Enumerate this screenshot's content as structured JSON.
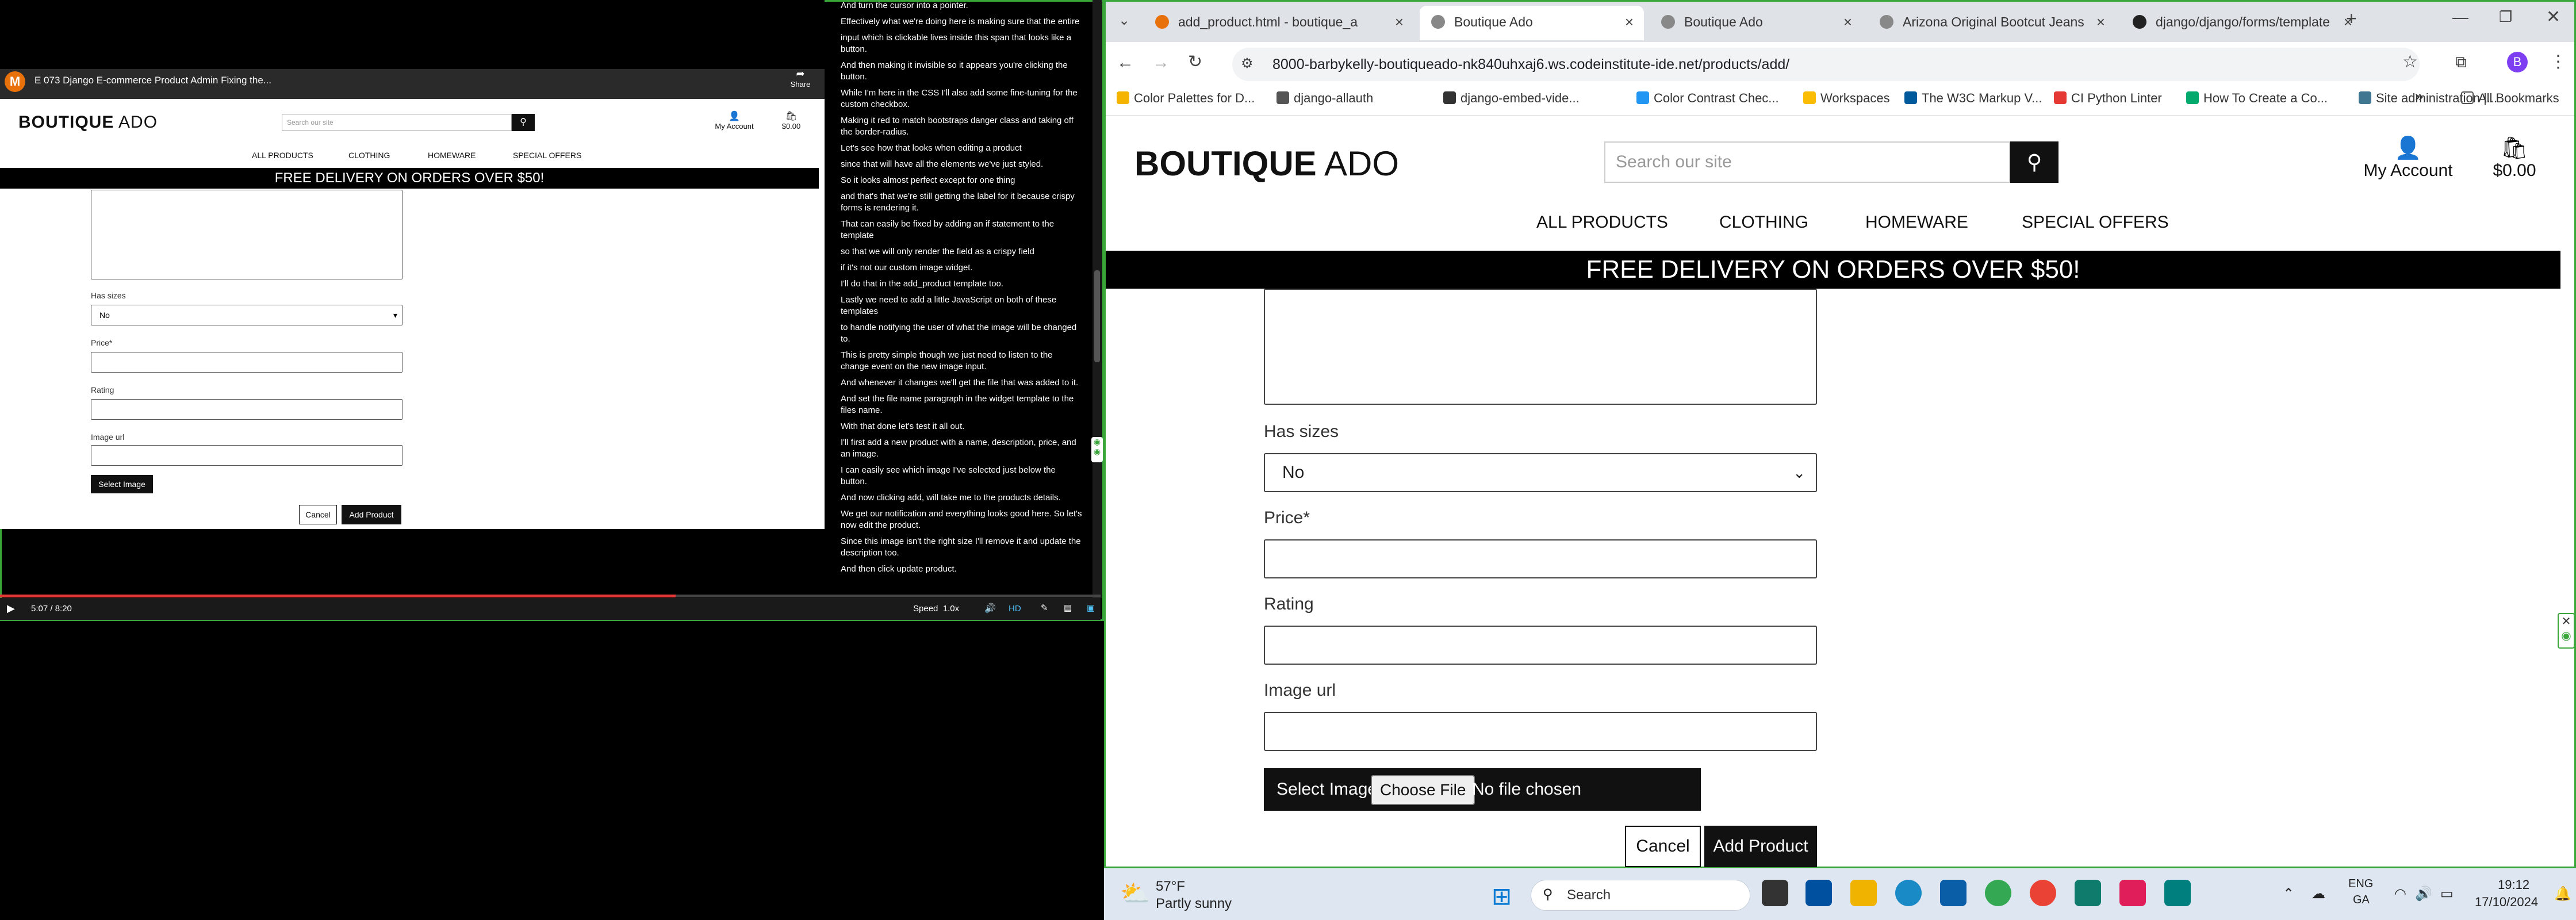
{
  "video": {
    "title": "E 073 Django E-commerce Product Admin Fixing the...",
    "avatar_letter": "M",
    "share_label": "Share",
    "time": "5:07 / 8:20",
    "progress": 0.614,
    "speed_label": "Speed",
    "speed_value": "1.0x",
    "quality": "HD",
    "site": {
      "logo_bold": "BOUTIQUE",
      "logo_light": "ADO",
      "search_placeholder": "Search our site",
      "account_label": "My Account",
      "cart_total": "$0.00",
      "nav": [
        "ALL PRODUCTS",
        "CLOTHING",
        "HOMEWARE",
        "SPECIAL OFFERS"
      ],
      "banner": "FREE DELIVERY ON ORDERS OVER $50!",
      "has_sizes_label": "Has sizes",
      "has_sizes_value": "No",
      "price_label": "Price*",
      "rating_label": "Rating",
      "image_url_label": "Image url",
      "select_image": "Select Image",
      "cancel": "Cancel",
      "add_product": "Add Product"
    },
    "captions": [
      "And turn the cursor into a pointer.",
      "Effectively what we're doing here is making sure that the entire",
      "input which is clickable lives inside this span that looks like a button.",
      "And then making it invisible so it appears you're clicking the button.",
      "While I'm here in the CSS I'll also add some fine-tuning for the custom checkbox.",
      "Making it red to match bootstraps danger class and taking off the border-radius.",
      "Let's see how that looks when editing a product",
      "since that will have all the elements we've just styled.",
      "So it looks almost perfect except for one thing",
      "and that's that we're still getting the label for it because crispy forms is rendering it.",
      "That can easily be fixed by adding an if statement to the template",
      "so that we will only render the field as a crispy field",
      "if it's not our custom image widget.",
      "I'll do that in the add_product template too.",
      "Lastly we need to add a little JavaScript on both of these templates",
      "to handle notifying the user of what the image will be changed to.",
      "This is pretty simple though we just need to listen to the change event on the new image input.",
      "And whenever it changes we'll get the file that was added to it.",
      "And set the file name paragraph in the widget template to the files name.",
      "With that done let's test it all out.",
      "I'll first add a new product with a name, description, price, and an image.",
      "I can easily see which image I've selected just below the button.",
      "And now clicking add, will take me to the products details.",
      "We get our notification and everything looks good here. So let's now edit the product.",
      "Since this image isn't the right size I'll remove it and update the description too.",
      "And then click update product."
    ]
  },
  "browser": {
    "tabs": [
      {
        "title": "add_product.html - boutique_a",
        "color": "#e8710a"
      },
      {
        "title": "Boutique Ado",
        "color": "#888888"
      },
      {
        "title": "Boutique Ado",
        "color": "#888888"
      },
      {
        "title": "Arizona Original Bootcut Jeans",
        "color": "#888888"
      },
      {
        "title": "django/django/forms/template",
        "color": "#222222"
      }
    ],
    "new_tab": "+",
    "url": "8000-barbykelly-boutiqueado-nk840uhxaj6.ws.codeinstitute-ide.net/products/add/",
    "profile_letter": "B",
    "bookmarks": [
      {
        "label": "Color Palettes for D...",
        "color": "#f4b400"
      },
      {
        "label": "django-allauth",
        "color": "#555555"
      },
      {
        "label": "django-embed-vide...",
        "color": "#333333"
      },
      {
        "label": "Color Contrast Chec...",
        "color": "#2196f3"
      },
      {
        "label": "Workspaces",
        "color": "#fbbc04"
      },
      {
        "label": "The W3C Markup V...",
        "color": "#005a9c"
      },
      {
        "label": "CI Python Linter",
        "color": "#e53935"
      },
      {
        "label": "How To Create a Co...",
        "color": "#04aa6d"
      },
      {
        "label": "Site administration |...",
        "color": "#417690"
      }
    ],
    "more_bookmarks": "»",
    "all_bookmarks": "All Bookmarks",
    "site": {
      "logo_bold": "BOUTIQUE",
      "logo_light": "ADO",
      "search_placeholder": "Search our site",
      "account_label": "My Account",
      "cart_total": "$0.00",
      "nav": [
        "ALL PRODUCTS",
        "CLOTHING",
        "HOMEWARE",
        "SPECIAL OFFERS"
      ],
      "banner": "FREE DELIVERY ON ORDERS OVER $50!",
      "has_sizes_label": "Has sizes",
      "has_sizes_value": "No",
      "price_label": "Price*",
      "rating_label": "Rating",
      "image_url_label": "Image url",
      "select_image": "Select Image",
      "choose_file": "Choose File",
      "no_file": "No file chosen",
      "cancel": "Cancel",
      "add_product": "Add Product"
    }
  },
  "taskbar": {
    "weather_temp": "57°F",
    "weather_desc": "Partly sunny",
    "search_label": "Search",
    "lang_top": "ENG",
    "lang_bottom": "GA",
    "time": "19:12",
    "date": "17/10/2024"
  }
}
